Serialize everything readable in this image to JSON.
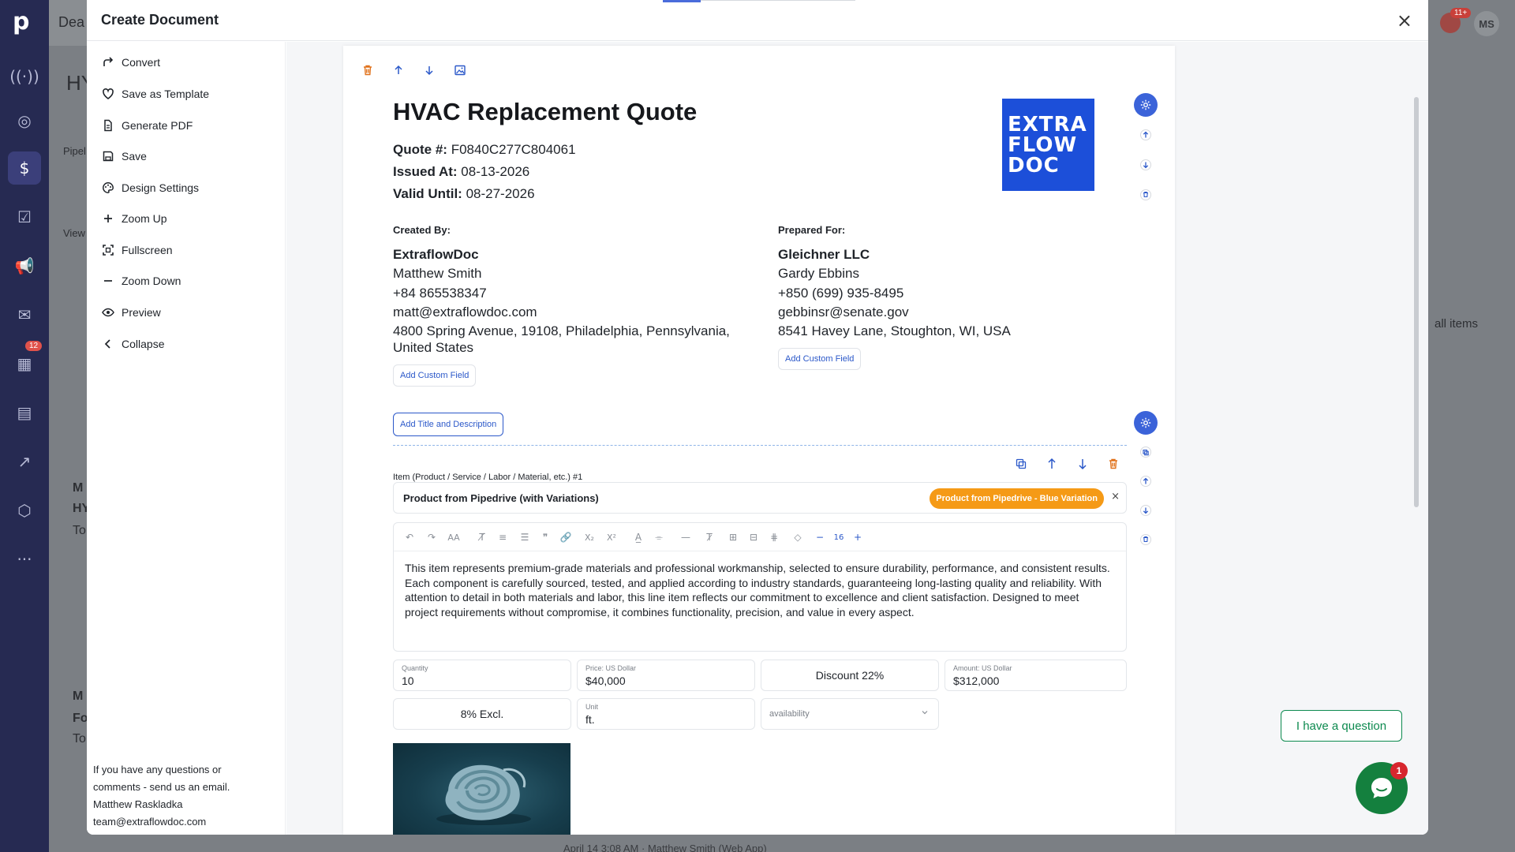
{
  "background": {
    "logo_letter": "p",
    "title_fragment": "Dea",
    "h_fragment": "HY",
    "calendar_badge": "12",
    "notification_badge": "11+",
    "user_initials": "MS",
    "right_fragment": "all items",
    "footer_line": "April 14 3:08 AM · Matthew Smith (Web App)",
    "left_fragments": [
      "Pipel",
      "View",
      "M",
      "HY",
      "To",
      "M",
      "Fo",
      "To"
    ]
  },
  "modal": {
    "title": "Create Document",
    "close_label": "×"
  },
  "actions": [
    {
      "label": "Convert",
      "icon": "convert-icon"
    },
    {
      "label": "Save as Template",
      "icon": "heart-icon"
    },
    {
      "label": "Generate PDF",
      "icon": "pdf-file-icon"
    },
    {
      "label": "Save",
      "icon": "save-icon"
    },
    {
      "label": "Design Settings",
      "icon": "palette-icon"
    },
    {
      "label": "Zoom Up",
      "icon": "plus-icon"
    },
    {
      "label": "Fullscreen",
      "icon": "fullscreen-icon"
    },
    {
      "label": "Zoom Down",
      "icon": "minus-icon"
    },
    {
      "label": "Preview",
      "icon": "eye-icon"
    },
    {
      "label": "Collapse",
      "icon": "chevron-left-icon"
    }
  ],
  "help": {
    "line1": "If you have any questions or",
    "line2": "comments - send us an email.",
    "name": "Matthew Raskladka",
    "email": "team@extraflowdoc.com"
  },
  "document": {
    "title": "HVAC Replacement Quote",
    "quote_label": "Quote #:",
    "quote_value": "F0840C277C804061",
    "issued_label": "Issued At:",
    "issued_value": "08-13-2026",
    "valid_label": "Valid Until:",
    "valid_value": "08-27-2026",
    "logo_lines": [
      "EXTRA",
      "FLOW",
      "DOC"
    ],
    "created_by": {
      "label": "Created By:",
      "company": "ExtraflowDoc",
      "name": "Matthew Smith",
      "phone": "+84 865538347",
      "email": "matt@extraflowdoc.com",
      "address": "4800 Spring Avenue, 19108, Philadelphia, Pennsylvania, United States",
      "add_field": "Add Custom Field"
    },
    "prepared_for": {
      "label": "Prepared For:",
      "company": "Gleichner LLC",
      "name": "Gardy Ebbins",
      "phone": "+850 (699) 935-8495",
      "email": "gebbinsr@senate.gov",
      "address": "8541 Havey Lane, Stoughton, WI, USA",
      "add_field": "Add Custom Field"
    },
    "add_title_description": "Add Title and Description"
  },
  "item": {
    "label": "Item (Product / Service / Labor / Material, etc.) #1",
    "product_name": "Product from Pipedrive (with Variations)",
    "variation_chip": "Product from Pipedrive - Blue Variation",
    "font_size": "16",
    "description": "This item represents premium-grade materials and professional workmanship, selected to ensure durability, performance, and consistent results. Each component is carefully sourced, tested, and applied according to industry standards, guaranteeing long-lasting quality and reliability. With attention to detail in both materials and labor, this line item reflects our commitment to excellence and client satisfaction. Designed to meet project requirements without compromise, it combines functionality, precision, and value in every aspect.",
    "quantity_label": "Quantity",
    "quantity_value": "10",
    "price_label": "Price: US Dollar",
    "price_value": "$40,000",
    "discount": "Discount 22%",
    "amount_label": "Amount: US Dollar",
    "amount_value": "$312,000",
    "tax": "8% Excl.",
    "unit_label": "Unit",
    "unit_value": "ft.",
    "availability_placeholder": "availability"
  },
  "widgets": {
    "question_label": "I have a question",
    "chat_badge": "1"
  },
  "colors": {
    "accent_blue": "#2b58c9",
    "logo_blue": "#1c4fd9",
    "chip_orange": "#f59a16",
    "delete_orange": "#e0711a",
    "chat_green": "#14803e",
    "sidebar_navy": "#262a52"
  }
}
